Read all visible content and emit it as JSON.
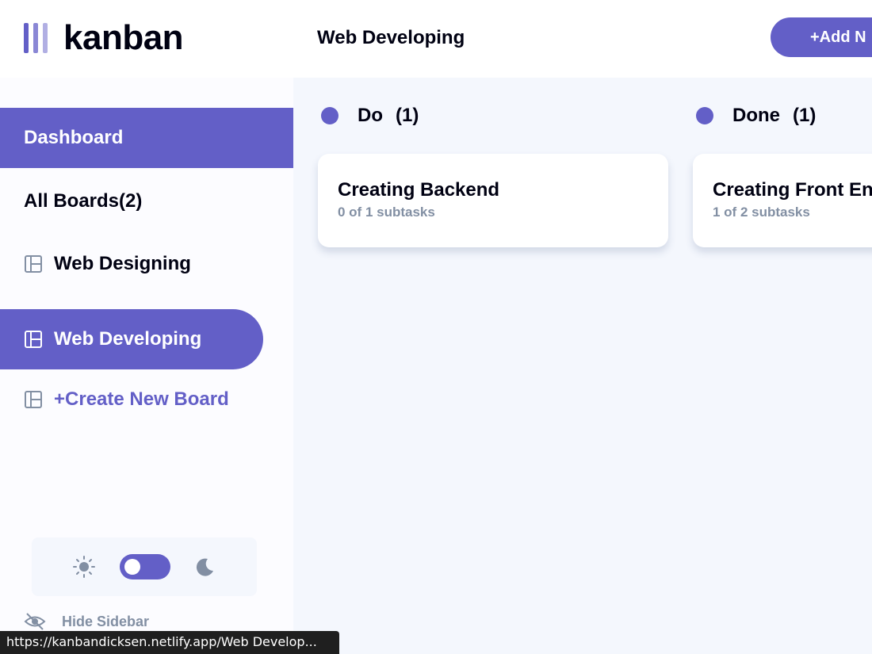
{
  "header": {
    "logo_text": "kanban",
    "board_title": "Web Developing",
    "add_task_label": "+Add N"
  },
  "sidebar": {
    "dashboard_label": "Dashboard",
    "all_boards_label": "All Boards(2)",
    "boards": [
      {
        "label": "Web Designing",
        "active": false,
        "icon": "board-icon"
      },
      {
        "label": "Web Developing",
        "active": true,
        "icon": "board-icon"
      }
    ],
    "create_board_label": "+Create New Board",
    "theme": {
      "light_icon": "sun-icon",
      "dark_icon": "moon-icon",
      "toggle_state": "light"
    },
    "hide_sidebar_label": "Hide Sidebar"
  },
  "columns": [
    {
      "name": "Do",
      "count": "(1)",
      "dot_color": "#635fc7",
      "tasks": [
        {
          "title": "Creating Backend",
          "subtasks": "0 of 1 subtasks"
        }
      ]
    },
    {
      "name": "Done",
      "count": "(1)",
      "dot_color": "#635fc7",
      "tasks": [
        {
          "title": "Creating Front En",
          "subtasks": "1 of 2 subtasks"
        }
      ]
    }
  ],
  "status_url": "https://kanbandicksen.netlify.app/Web Develop...",
  "colors": {
    "accent": "#635fc7",
    "board_bg": "#f4f7fd",
    "muted_text": "#828fa3"
  }
}
